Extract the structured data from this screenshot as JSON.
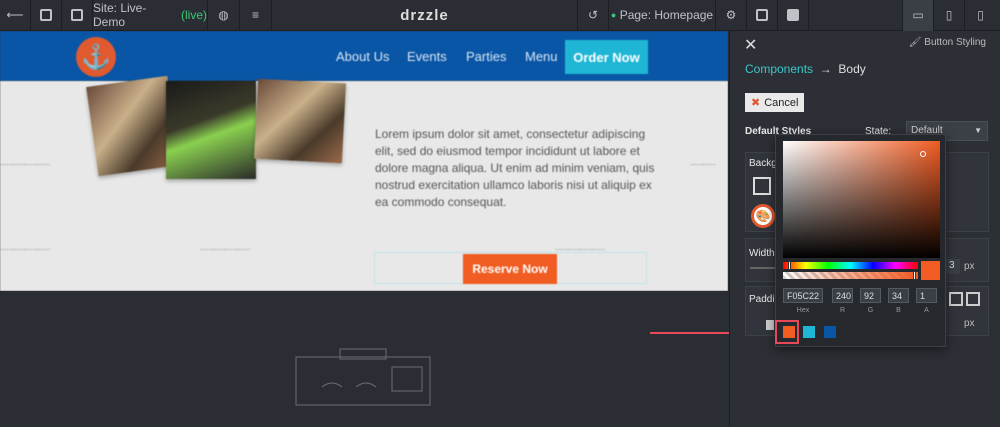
{
  "topbar": {
    "site_label": "Site: Live-Demo",
    "site_status": "(live)",
    "brand": "drzzle",
    "page_label": "Page: Homepage"
  },
  "site": {
    "nav": [
      "About Us",
      "Events",
      "Parties",
      "Menu"
    ],
    "order_button": "Order Now",
    "lorem": "Lorem ipsum dolor sit amet, consectetur adipiscing elit, sed do eiusmod tempor incididunt ut labore et dolore magna aliqua. Ut enim ad minim veniam, quis nostrud exercitation ullamco laboris nisi ut aliquip ex ea commodo consequat.",
    "reserve_button": "Reserve Now"
  },
  "panel": {
    "button_styling": "Button Styling",
    "breadcrumb_components": "Components",
    "breadcrumb_body": "Body",
    "cancel": "Cancel",
    "default_styles": "Default Styles",
    "state_label": "State:",
    "state_value": "Default",
    "background_label": "Backg",
    "width_label": "Width",
    "width_value": "3",
    "width_unit": "px",
    "padding_label": "Paddi",
    "padding_unit": "px"
  },
  "picker": {
    "hex": "F05C22",
    "r": "240",
    "g": "92",
    "b": "34",
    "a": "1",
    "hex_label": "Hex",
    "r_label": "R",
    "g_label": "G",
    "b_label": "B",
    "a_label": "A",
    "swatches": [
      "#f05c22",
      "#1fb6d6",
      "#0a56a6"
    ]
  },
  "colors": {
    "accent": "#f05c22",
    "teal": "#1fb6d6",
    "nav_blue": "#0a56a6",
    "arrow": "#e64a5a",
    "live_green": "#3cc67a"
  }
}
